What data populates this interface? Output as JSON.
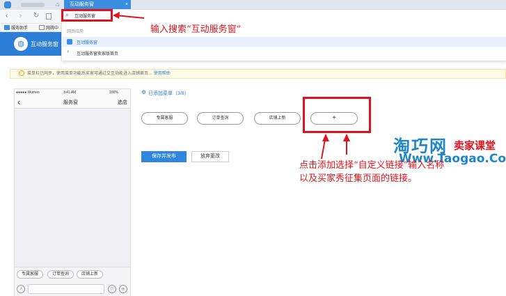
{
  "browser": {
    "tab_title": "互动服务窗",
    "tab_close": "×",
    "bookmarks": [
      "服务助手",
      "网购中"
    ]
  },
  "dropdown": {
    "search_value": "互动服务窗",
    "section_label": "网页应用",
    "result_1": "互动服务窗",
    "result_2": "互动服务窗卖家版首页"
  },
  "site": {
    "name": "互动服务窗"
  },
  "notice": {
    "text": "菜单栏已同步，使用菜单功能后买家可通过交互功能进入店铺首页…",
    "link": "使用帮助"
  },
  "phone": {
    "carrier": "●●●●● Wumen",
    "time": "3:41 AM",
    "battery": "100%",
    "title": "服务窗",
    "right_action": "选店",
    "back": "‹",
    "footer_buttons": [
      "专属客服",
      "订单查询",
      "店铺上新"
    ]
  },
  "main": {
    "menu_header": "已添加菜单（3/8）",
    "menu_items": [
      "专属客服",
      "订单查询",
      "店铺上新"
    ],
    "add_button": "+",
    "save_label": "保存并发布",
    "discard_label": "放弃更改"
  },
  "annotations": {
    "search_note": "输入搜索“互动服务窗”",
    "add_note_line1": "点击添加选择“自定义链接”输入名称",
    "add_note_line2": "以及买家秀征集页面的链接。"
  },
  "watermark": {
    "title": "淘巧网",
    "subtitle": "卖家课堂",
    "url": "Www.Taogao.Com"
  },
  "colors": {
    "accent": "#2c7ed6",
    "annotation_red": "#e0121b",
    "watermark_blue": "#1e86c8"
  }
}
